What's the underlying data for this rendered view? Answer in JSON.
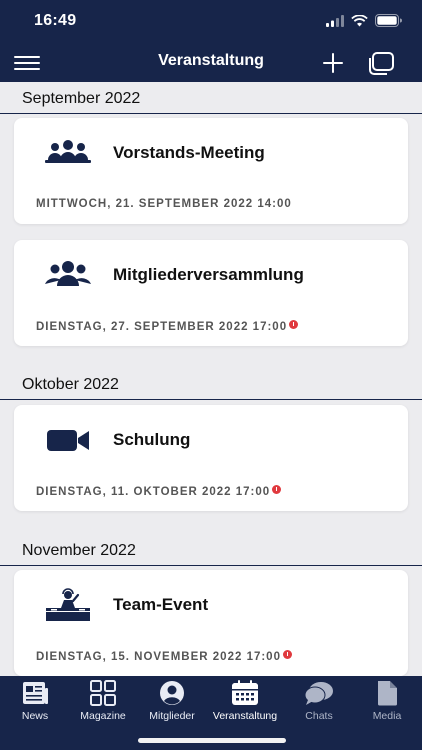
{
  "status_bar": {
    "time": "16:49"
  },
  "nav": {
    "title": "Veranstaltung"
  },
  "sections": [
    {
      "label": "September 2022"
    },
    {
      "label": "Oktober 2022"
    },
    {
      "label": "November 2022"
    }
  ],
  "events": [
    {
      "name": "Vorstands-Meeting",
      "date": "MITTWOCH, 21. SEPTEMBER 2022 14:00",
      "icon": "meeting-group-icon",
      "alert": false
    },
    {
      "name": "Mitgliederversammlung",
      "date": "DIENSTAG, 27. SEPTEMBER 2022 17:00",
      "icon": "people-group-icon",
      "alert": true
    },
    {
      "name": "Schulung",
      "date": "DIENSTAG, 11. OKTOBER 2022 17:00",
      "icon": "video-camera-icon",
      "alert": true
    },
    {
      "name": "Team-Event",
      "date": "DIENSTAG, 15. NOVEMBER 2022 17:00",
      "icon": "dj-icon",
      "alert": true
    }
  ],
  "tabs": [
    {
      "label": "News",
      "icon": "newspaper-icon"
    },
    {
      "label": "Magazine",
      "icon": "grid-icon"
    },
    {
      "label": "Mitglieder",
      "icon": "person-circle-icon"
    },
    {
      "label": "Veranstaltung",
      "icon": "calendar-icon"
    },
    {
      "label": "Chats",
      "icon": "chat-bubbles-icon"
    },
    {
      "label": "Media",
      "icon": "file-icon"
    }
  ],
  "colors": {
    "primary": "#17254a",
    "alert": "#e0393e",
    "background": "#ececef"
  }
}
